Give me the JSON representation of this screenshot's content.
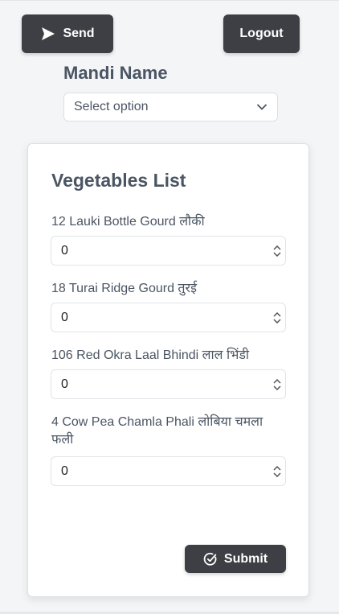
{
  "header": {
    "send_label": "Send",
    "logout_label": "Logout"
  },
  "mandi": {
    "title": "Mandi Name",
    "select_value": "Select option"
  },
  "card": {
    "title": "Vegetables List",
    "items": [
      {
        "label": "12 Lauki Bottle Gourd लौकी",
        "value": "0"
      },
      {
        "label": "18 Turai Ridge Gourd तुरई",
        "value": "0"
      },
      {
        "label": "106 Red Okra Laal Bhindi लाल भिंडी",
        "value": "0"
      },
      {
        "label": "4 Cow Pea Chamla Phali लोबिया चमला फली",
        "value": "0"
      }
    ],
    "submit_label": "Submit"
  },
  "icons": {
    "send": "send-icon",
    "chevron": "chevron-down-icon",
    "submit": "check-circle-icon",
    "spinner": "spinner-arrows-icon"
  },
  "colors": {
    "button_bg": "#3d3f44",
    "page_bg": "#f4f5f7",
    "text": "#4b5563"
  }
}
